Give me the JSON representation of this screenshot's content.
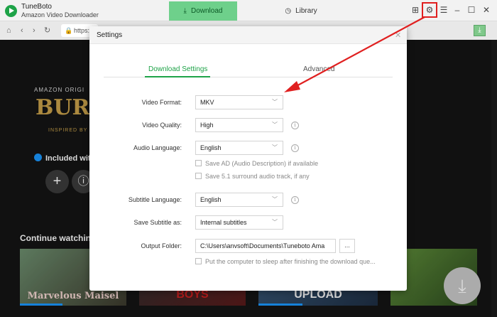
{
  "app": {
    "name": "TuneBoto",
    "subtitle": "Amazon Video Downloader"
  },
  "tabs": {
    "download": "Download",
    "library": "Library"
  },
  "browser": {
    "url": "https:"
  },
  "background": {
    "brand": "AMAZON ORIGI",
    "show_title": "BURI",
    "tagline": "INSPIRED BY T",
    "included": "Included with",
    "section": "Continue watching",
    "thumbs": [
      "Marvelous Maisel",
      "BOYS",
      "UPLOAD",
      ""
    ]
  },
  "settings": {
    "title": "Settings",
    "tabs": {
      "download": "Download Settings",
      "advanced": "Advanced"
    },
    "video_format": {
      "label": "Video Format:",
      "value": "MKV"
    },
    "video_quality": {
      "label": "Video Quality:",
      "value": "High"
    },
    "audio_language": {
      "label": "Audio Language:",
      "value": "English"
    },
    "save_ad": "Save AD (Audio Description) if available",
    "save_51": "Save 5.1 surround audio track, if any",
    "subtitle_language": {
      "label": "Subtitle Language:",
      "value": "English"
    },
    "save_subtitle": {
      "label": "Save Subtitle as:",
      "value": "Internal subtitles"
    },
    "output_folder": {
      "label": "Output Folder:",
      "value": "C:\\Users\\anvsoft\\Documents\\Tuneboto Ama",
      "button": "..."
    },
    "sleep": "Put the computer to sleep after finishing the download que..."
  },
  "colors": {
    "accent": "#1ea348",
    "highlight": "#e02020"
  }
}
